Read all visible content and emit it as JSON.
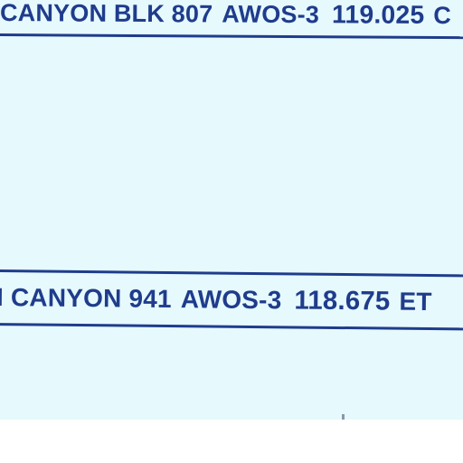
{
  "labels": [
    {
      "ident": "CANYON BLK 807",
      "type": "AWOS-3",
      "freq": "119.025",
      "trail": "C"
    },
    {
      "ident": "I CANYON 941",
      "type": "AWOS-3",
      "freq": "118.675",
      "trail": "ET"
    }
  ],
  "colors": {
    "ink": "#1f3c8c",
    "chart": "#e6f9fd",
    "margin": "#ffffff"
  }
}
